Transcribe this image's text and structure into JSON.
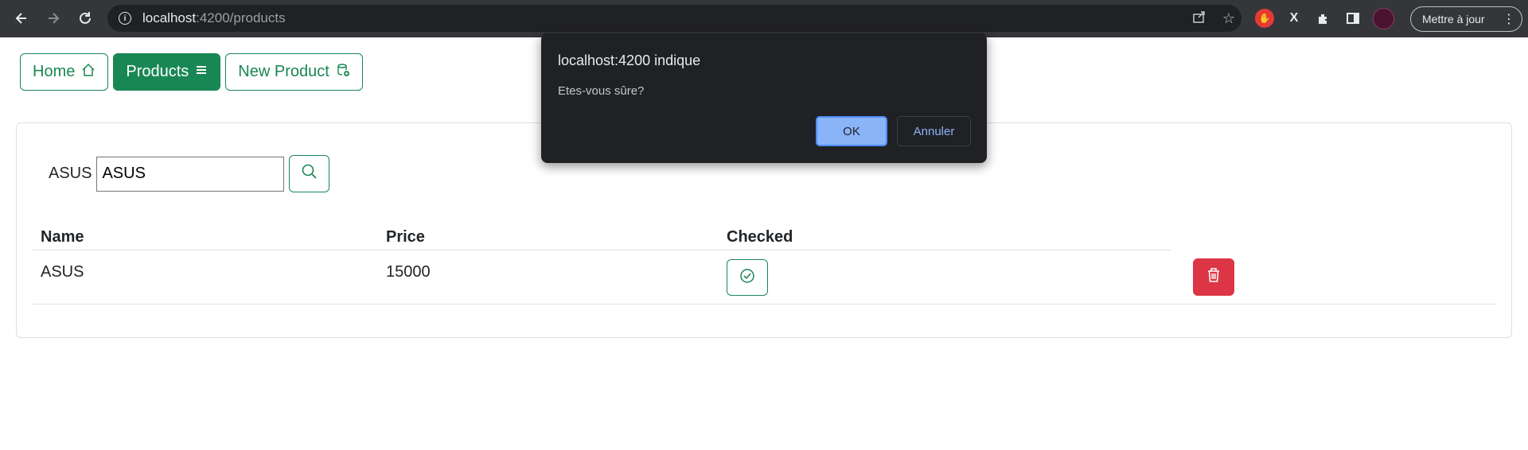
{
  "browser": {
    "url_host": "localhost",
    "url_path": ":4200/products",
    "update_label": "Mettre à jour",
    "icons": [
      "back-icon",
      "forward-icon",
      "reload-icon",
      "info-icon",
      "share-icon",
      "star-icon",
      "extension-icon",
      "sidebar-icon",
      "profile-icon",
      "menu-icon"
    ]
  },
  "nav": {
    "home_label": "Home",
    "products_label": "Products",
    "new_product_label": "New Product"
  },
  "search": {
    "label": "ASUS",
    "value": "ASUS"
  },
  "table": {
    "headers": [
      "Name",
      "Price",
      "Checked"
    ],
    "rows": [
      {
        "name": "ASUS",
        "price": "15000",
        "checked": true
      }
    ]
  },
  "dialog": {
    "title": "localhost:4200 indique",
    "message": "Etes-vous sûre?",
    "ok_label": "OK",
    "cancel_label": "Annuler"
  },
  "colors": {
    "primary_green": "#198754",
    "danger_red": "#dc3545",
    "dialog_bg": "#202124",
    "dialog_accent": "#8ab4f8"
  }
}
